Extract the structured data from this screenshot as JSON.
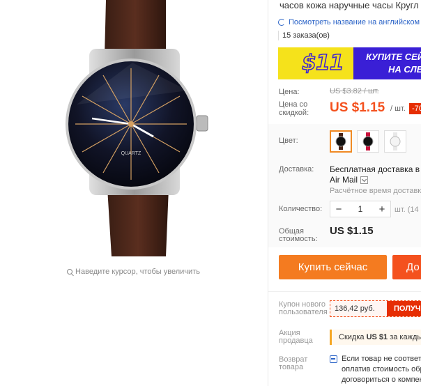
{
  "product": {
    "title": "часов кожа наручные часы Кругл",
    "translate_link": "Посмотреть название на английском",
    "orders": "15 заказа(ов)",
    "zoom_hint": "Наведите курсор, чтобы увеличить",
    "watch_brand": "QUARTZ"
  },
  "banner": {
    "amount": "$11",
    "line1": "КУПИТЕ СЕЙЧ",
    "line2": "НА СЛЕ",
    "colors": {
      "yellow": "#f5e21b",
      "blue": "#3a1fd6"
    }
  },
  "pricing": {
    "price_label": "Цена:",
    "old_price": "US $3.82 / шт.",
    "discount_label_line1": "Цена со",
    "discount_label_line2": "скидкой:",
    "new_price": "US $1.15",
    "per_unit": "/ шт.",
    "discount_badge": "-70",
    "accent_color": "#f4511e"
  },
  "options": {
    "color_label": "Цвет:",
    "color_swatches": [
      "black-brown",
      "black-red",
      "white"
    ],
    "selected_swatch": 0
  },
  "shipping": {
    "label": "Доставка:",
    "method_line1": "Бесплатная доставка в R",
    "method_line2": "Air Mail",
    "estimate": "Расчётное время доставки"
  },
  "quantity": {
    "label": "Количество:",
    "value": "1",
    "minus": "−",
    "plus": "+",
    "available": "шт. (14 с"
  },
  "total": {
    "label_line1": "Общая",
    "label_line2": "стоимость:",
    "value": "US $1.15"
  },
  "actions": {
    "buy_now": "Купить сейчас",
    "add_to_cart": "До"
  },
  "coupon": {
    "label_line1": "Купон нового",
    "label_line2": "пользователя",
    "value": "136,42 руб.",
    "get_button": "ПОЛУЧ"
  },
  "promo": {
    "label_line1": "Акция",
    "label_line2": "продавца",
    "text_prefix": "Скидка ",
    "text_amount": "US $1",
    "text_suffix": " за кажды"
  },
  "returns": {
    "label_line1": "Возврат",
    "label_line2": "товара",
    "line1": "Если товар не соответс",
    "line2": "оплатив стоимость обр",
    "line3": "договориться о компен"
  }
}
